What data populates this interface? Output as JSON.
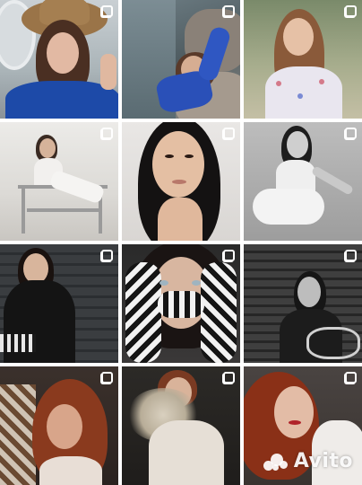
{
  "gallery": {
    "tiles": [
      {
        "name": "photo-hat-woman",
        "multi": true
      },
      {
        "name": "photo-rocks-woman",
        "multi": true
      },
      {
        "name": "photo-floral-woman",
        "multi": true
      },
      {
        "name": "photo-chair-woman",
        "multi": true
      },
      {
        "name": "photo-portrait-woman",
        "multi": true
      },
      {
        "name": "photo-bw-sitting-woman",
        "multi": true
      },
      {
        "name": "photo-leather-coat-woman",
        "multi": true
      },
      {
        "name": "photo-zebra-hands-woman",
        "multi": true
      },
      {
        "name": "photo-blinds-woman",
        "multi": true
      },
      {
        "name": "photo-red-hair-woman",
        "multi": true
      },
      {
        "name": "photo-dried-flowers-woman",
        "multi": true
      },
      {
        "name": "photo-curly-red-hair-woman",
        "multi": true
      }
    ]
  },
  "watermark": {
    "text": "Avito"
  }
}
